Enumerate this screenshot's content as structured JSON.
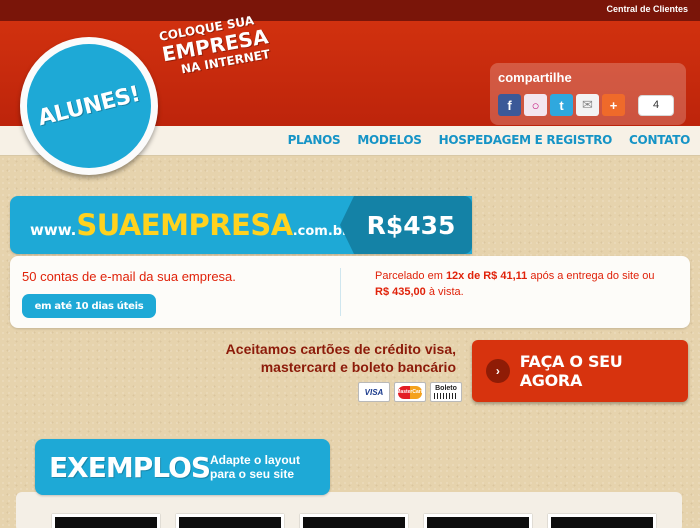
{
  "top_bar": {
    "client_link": "Central de Clientes"
  },
  "logo": {
    "text": "ALUNES!"
  },
  "tagline": {
    "line1": "COLOQUE SUA",
    "line2": "EMPRESA",
    "line3": "NA INTERNET"
  },
  "share": {
    "title": "compartilhe",
    "icons": [
      "facebook-icon",
      "orkut-icon",
      "twitter-icon",
      "email-icon",
      "addthis-plus-icon"
    ],
    "count": "4"
  },
  "nav": {
    "items": [
      {
        "label": "PLANOS"
      },
      {
        "label": "MODELOS"
      },
      {
        "label": "HOSPEDAGEM E REGISTRO"
      },
      {
        "label": "CONTATO"
      }
    ]
  },
  "banner": {
    "www": "www.",
    "domain": "SUAEMPRESA",
    "tld": ".com.br",
    "price": "R$435"
  },
  "info": {
    "emails": "50 contas de e-mail da sua empresa.",
    "delivery": "em até 10 dias úteis",
    "installments_prefix": "Parcelado em ",
    "installments_bold": "12x de R$ 41,11",
    "installments_suffix": " após a entrega do site ou",
    "cash_bold": "R$ 435,00",
    "cash_suffix": " à vista."
  },
  "payment": {
    "line1": "Aceitamos cartões de crédito visa,",
    "line2": "mastercard e boleto bancário",
    "cards": {
      "visa": "VISA",
      "master": "MasterCard",
      "boleto": "Boleto"
    }
  },
  "cta": {
    "arrow": "›",
    "label": "FAÇA O SEU AGORA"
  },
  "examples": {
    "title": "EXEMPLOS",
    "subtitle": "Adapte o layout para o seu site",
    "thumb_count": 5
  },
  "colors": {
    "header_red": "#c9290f",
    "top_strip": "#7a1509",
    "accent_blue": "#1ea9d6",
    "price_blue": "#1482a6",
    "domain_yellow": "#ffd21f",
    "text_red": "#e0220a",
    "cta_red": "#d7330e"
  }
}
